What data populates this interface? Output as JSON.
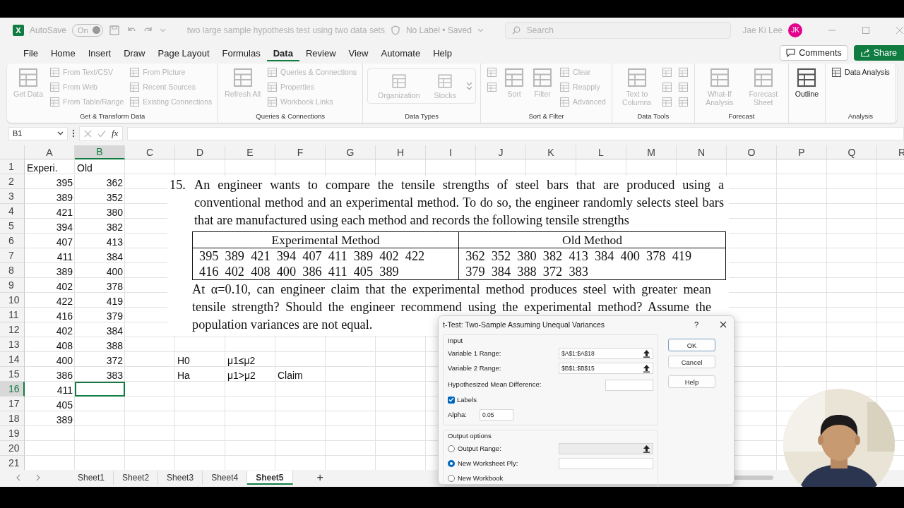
{
  "title_bar": {
    "logo": "X",
    "autosave": {
      "label": "AutoSave",
      "state_label": "On",
      "on": true
    },
    "document_title": "two large sample hypothesis test using two data sets",
    "status": "No Label • Saved",
    "search": {
      "placeholder": "Search"
    },
    "user": {
      "name": "Jae Ki Lee",
      "initials": "JK"
    }
  },
  "menu_tabs": [
    {
      "label": "File",
      "selected": false
    },
    {
      "label": "Home",
      "selected": false
    },
    {
      "label": "Insert",
      "selected": false
    },
    {
      "label": "Draw",
      "selected": false
    },
    {
      "label": "Page Layout",
      "selected": false
    },
    {
      "label": "Formulas",
      "selected": false
    },
    {
      "label": "Data",
      "selected": true
    },
    {
      "label": "Review",
      "selected": false
    },
    {
      "label": "View",
      "selected": false
    },
    {
      "label": "Automate",
      "selected": false
    },
    {
      "label": "Help",
      "selected": false
    }
  ],
  "comments_button": "Comments",
  "share_button": "Share",
  "ribbon_groups": [
    {
      "label": "Get & Transform Data",
      "items": [
        {
          "kind": "large",
          "label": "Get Data",
          "disabled": true
        },
        {
          "kind": "small",
          "label": "From Text/CSV",
          "disabled": true
        },
        {
          "kind": "small",
          "label": "From Web",
          "disabled": true
        },
        {
          "kind": "small",
          "label": "From Table/Range",
          "disabled": true
        },
        {
          "kind": "small",
          "label": "From Picture",
          "disabled": true
        },
        {
          "kind": "small",
          "label": "Recent Sources",
          "disabled": true
        },
        {
          "kind": "small",
          "label": "Existing Connections",
          "disabled": true
        }
      ]
    },
    {
      "label": "Queries & Connections",
      "items": [
        {
          "kind": "large",
          "label": "Refresh All",
          "disabled": true
        },
        {
          "kind": "small",
          "label": "Queries & Connections",
          "disabled": true
        },
        {
          "kind": "small",
          "label": "Properties",
          "disabled": true
        },
        {
          "kind": "small",
          "label": "Workbook Links",
          "disabled": true
        }
      ]
    },
    {
      "label": "Data Types",
      "items": [
        {
          "kind": "tile",
          "label": "Organization",
          "disabled": true
        },
        {
          "kind": "tile",
          "label": "Stocks",
          "disabled": true
        }
      ]
    },
    {
      "label": "Sort & Filter",
      "items": [
        {
          "kind": "icon",
          "disabled": true
        },
        {
          "kind": "icon",
          "disabled": true
        },
        {
          "kind": "large",
          "label": "Sort",
          "disabled": true
        },
        {
          "kind": "large",
          "label": "Filter",
          "disabled": true
        },
        {
          "kind": "small",
          "label": "Clear",
          "disabled": true
        },
        {
          "kind": "small",
          "label": "Reapply",
          "disabled": true
        },
        {
          "kind": "small",
          "label": "Advanced",
          "disabled": true
        }
      ]
    },
    {
      "label": "Data Tools",
      "items": [
        {
          "kind": "large",
          "label": "Text to Columns",
          "disabled": true
        },
        {
          "kind": "icon",
          "disabled": true
        },
        {
          "kind": "icon",
          "disabled": true
        },
        {
          "kind": "icon",
          "disabled": true
        },
        {
          "kind": "icon2",
          "disabled": true
        },
        {
          "kind": "icon2",
          "disabled": true
        },
        {
          "kind": "icon2",
          "disabled": true
        }
      ]
    },
    {
      "label": "Forecast",
      "items": [
        {
          "kind": "large",
          "label": "What-If Analysis",
          "disabled": true
        },
        {
          "kind": "large",
          "label": "Forecast Sheet",
          "disabled": true
        }
      ]
    },
    {
      "items": [
        {
          "kind": "large",
          "label": "Outline",
          "disabled": false
        }
      ]
    },
    {
      "label": "Analysis",
      "items": [
        {
          "kind": "small",
          "label": "Data Analysis",
          "disabled": false
        }
      ]
    }
  ],
  "formula_bar": {
    "name_box": "B1",
    "function_label": "fx"
  },
  "sheet": {
    "columns": [
      {
        "label": "A",
        "selected": false
      },
      {
        "label": "B",
        "selected": true
      },
      {
        "label": "C",
        "selected": false
      },
      {
        "label": "D",
        "selected": false
      },
      {
        "label": "E",
        "selected": false
      },
      {
        "label": "F",
        "selected": false
      },
      {
        "label": "G",
        "selected": false
      },
      {
        "label": "H",
        "selected": false
      },
      {
        "label": "I",
        "selected": false
      },
      {
        "label": "J",
        "selected": false
      },
      {
        "label": "K",
        "selected": false
      },
      {
        "label": "L",
        "selected": false
      },
      {
        "label": "M",
        "selected": false
      },
      {
        "label": "N",
        "selected": false
      },
      {
        "label": "O",
        "selected": false
      },
      {
        "label": "P",
        "selected": false
      },
      {
        "label": "Q",
        "selected": false
      },
      {
        "label": "R",
        "selected": false
      }
    ],
    "rows": [
      {
        "number": "1",
        "selected": false,
        "cells": [
          "Experi.",
          "Old"
        ]
      },
      {
        "number": "2",
        "selected": false,
        "cells": [
          "395",
          "362"
        ]
      },
      {
        "number": "3",
        "selected": false,
        "cells": [
          "389",
          "352"
        ]
      },
      {
        "number": "4",
        "selected": false,
        "cells": [
          "421",
          "380"
        ]
      },
      {
        "number": "5",
        "selected": false,
        "cells": [
          "394",
          "382"
        ]
      },
      {
        "number": "6",
        "selected": false,
        "cells": [
          "407",
          "413"
        ]
      },
      {
        "number": "7",
        "selected": false,
        "cells": [
          "411",
          "384"
        ]
      },
      {
        "number": "8",
        "selected": false,
        "cells": [
          "389",
          "400"
        ]
      },
      {
        "number": "9",
        "selected": false,
        "cells": [
          "402",
          "378"
        ]
      },
      {
        "number": "10",
        "selected": false,
        "cells": [
          "422",
          "419"
        ]
      },
      {
        "number": "11",
        "selected": false,
        "cells": [
          "416",
          "379"
        ]
      },
      {
        "number": "12",
        "selected": false,
        "cells": [
          "402",
          "384"
        ]
      },
      {
        "number": "13",
        "selected": false,
        "cells": [
          "408",
          "388"
        ]
      },
      {
        "number": "14",
        "selected": false,
        "cells": [
          "400",
          "372",
          null,
          "H0",
          "μ1≤μ2"
        ]
      },
      {
        "number": "15",
        "selected": false,
        "cells": [
          "386",
          "383",
          null,
          "Ha",
          "μ1>μ2",
          "Claim"
        ]
      },
      {
        "number": "16",
        "selected": true,
        "cells": [
          "411"
        ]
      },
      {
        "number": "17",
        "selected": false,
        "cells": [
          "405"
        ]
      },
      {
        "number": "18",
        "selected": false,
        "cells": [
          "389"
        ]
      },
      {
        "number": "19",
        "selected": false
      },
      {
        "number": "20",
        "selected": false
      },
      {
        "number": "21",
        "selected": false
      }
    ]
  },
  "problem": {
    "number": "15.",
    "intro": "An engineer wants to compare the tensile strengths of steel bars that are produced using a conventional method and an experimental method. To do so, the engineer randomly selects steel bars that are manufactured using each method and records the following tensile strengths",
    "table": {
      "headers": [
        "Experimental Method",
        "Old Method"
      ],
      "cells": [
        [
          "395  389  421  394  407  411  389  402  422",
          "416  402  408  400  386  411  405  389"
        ],
        [
          "362  352  380  382  413  384  400  378  419",
          "379  384  388  372  383"
        ]
      ]
    },
    "question_lines": [
      "At α=0.10, can engineer claim that the experimental method produces steel with greater mean",
      "tensile strength? Should the engineer recommend using the experimental method?  Assume the",
      "population variances are not equal."
    ]
  },
  "dialog": {
    "title": "t-Test: Two-Sample Assuming Unequal Variances",
    "help_mark": "?",
    "input_label": "Input",
    "inputs": [
      {
        "kind": "range",
        "label": "Variable 1 Range:",
        "value": "$A$1:$A$18"
      },
      {
        "kind": "range",
        "label": "Variable 2 Range:",
        "value": "$B$1:$B$15"
      },
      {
        "kind": "wide",
        "label": "Hypothesized Mean Difference:"
      },
      {
        "kind": "checkbox",
        "label": "Labels",
        "checked": true
      },
      {
        "kind": "short",
        "label": "Alpha:",
        "value": "0.05"
      }
    ],
    "output_label": "Output options",
    "outputs": [
      {
        "label": "Output Range:",
        "selected": false,
        "field": {
          "kind": "range",
          "disabled": true
        }
      },
      {
        "label": "New Worksheet Ply:",
        "selected": true,
        "field": {
          "kind": "text",
          "disabled": false
        }
      },
      {
        "label": "New Workbook",
        "selected": false
      }
    ],
    "buttons": [
      "OK",
      "Cancel",
      "Help"
    ]
  },
  "sheet_tabs": [
    {
      "label": "Sheet1",
      "selected": false
    },
    {
      "label": "Sheet2",
      "selected": false
    },
    {
      "label": "Sheet3",
      "selected": false
    },
    {
      "label": "Sheet4",
      "selected": false
    },
    {
      "label": "Sheet5",
      "selected": true
    }
  ],
  "add_sheet": "+"
}
